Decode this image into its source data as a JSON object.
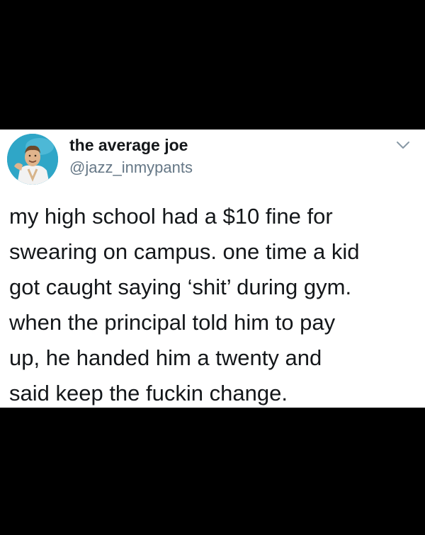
{
  "tweet": {
    "display_name": "the average joe",
    "handle": "@jazz_inmypants",
    "body_lines": [
      "my high school had a $10 fine for",
      "swearing on campus. one time a kid",
      "got caught saying ‘shit’ during gym.",
      "when the principal told him to pay",
      "up, he handed him a twenty and",
      "said keep the fuckin change."
    ],
    "more_icon": "chevron-down-icon"
  },
  "colors": {
    "background": "#000000",
    "card": "#ffffff",
    "text": "#14171a",
    "secondary_text": "#657786",
    "avatar_bg": "#2fa6c7"
  }
}
